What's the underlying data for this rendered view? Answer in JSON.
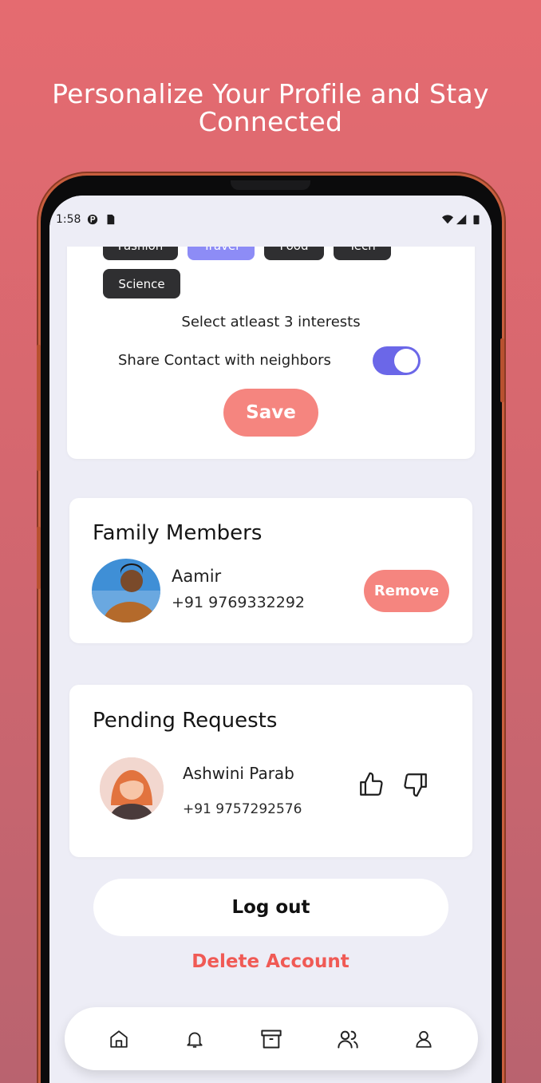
{
  "headline": "Personalize Your Profile and Stay Connected",
  "status_bar": {
    "time": "1:58"
  },
  "interests": {
    "chips": [
      {
        "label": "Fashion",
        "selected": false
      },
      {
        "label": "Travel",
        "selected": true
      },
      {
        "label": "Food",
        "selected": false
      },
      {
        "label": "Tech",
        "selected": false
      },
      {
        "label": "Science",
        "selected": false
      }
    ],
    "hint": "Select atleast 3 interests",
    "share_label": "Share Contact with neighbors",
    "share_enabled": true,
    "save_label": "Save"
  },
  "family": {
    "title": "Family Members",
    "member": {
      "name": "Aamir",
      "phone": "+91 9769332292"
    },
    "remove_label": "Remove"
  },
  "pending": {
    "title": "Pending Requests",
    "request": {
      "name": "Ashwini Parab",
      "phone": "+91 9757292576"
    }
  },
  "logout_label": "Log out",
  "delete_label": "Delete Account",
  "nav": [
    "home-icon",
    "bell-icon",
    "archive-icon",
    "users-icon",
    "profile-icon"
  ],
  "colors": {
    "accent": "#f5857f",
    "toggle": "#6b67e8",
    "chip_selected": "#8d8cf6",
    "danger": "#f05a55"
  }
}
